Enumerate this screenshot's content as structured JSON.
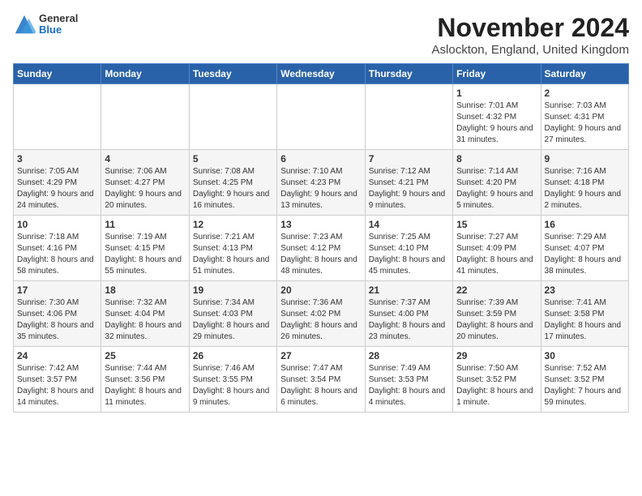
{
  "logo": {
    "general": "General",
    "blue": "Blue"
  },
  "title": "November 2024",
  "subtitle": "Aslockton, England, United Kingdom",
  "days_of_week": [
    "Sunday",
    "Monday",
    "Tuesday",
    "Wednesday",
    "Thursday",
    "Friday",
    "Saturday"
  ],
  "weeks": [
    [
      {
        "day": "",
        "info": ""
      },
      {
        "day": "",
        "info": ""
      },
      {
        "day": "",
        "info": ""
      },
      {
        "day": "",
        "info": ""
      },
      {
        "day": "",
        "info": ""
      },
      {
        "day": "1",
        "info": "Sunrise: 7:01 AM\nSunset: 4:32 PM\nDaylight: 9 hours and 31 minutes."
      },
      {
        "day": "2",
        "info": "Sunrise: 7:03 AM\nSunset: 4:31 PM\nDaylight: 9 hours and 27 minutes."
      }
    ],
    [
      {
        "day": "3",
        "info": "Sunrise: 7:05 AM\nSunset: 4:29 PM\nDaylight: 9 hours and 24 minutes."
      },
      {
        "day": "4",
        "info": "Sunrise: 7:06 AM\nSunset: 4:27 PM\nDaylight: 9 hours and 20 minutes."
      },
      {
        "day": "5",
        "info": "Sunrise: 7:08 AM\nSunset: 4:25 PM\nDaylight: 9 hours and 16 minutes."
      },
      {
        "day": "6",
        "info": "Sunrise: 7:10 AM\nSunset: 4:23 PM\nDaylight: 9 hours and 13 minutes."
      },
      {
        "day": "7",
        "info": "Sunrise: 7:12 AM\nSunset: 4:21 PM\nDaylight: 9 hours and 9 minutes."
      },
      {
        "day": "8",
        "info": "Sunrise: 7:14 AM\nSunset: 4:20 PM\nDaylight: 9 hours and 5 minutes."
      },
      {
        "day": "9",
        "info": "Sunrise: 7:16 AM\nSunset: 4:18 PM\nDaylight: 9 hours and 2 minutes."
      }
    ],
    [
      {
        "day": "10",
        "info": "Sunrise: 7:18 AM\nSunset: 4:16 PM\nDaylight: 8 hours and 58 minutes."
      },
      {
        "day": "11",
        "info": "Sunrise: 7:19 AM\nSunset: 4:15 PM\nDaylight: 8 hours and 55 minutes."
      },
      {
        "day": "12",
        "info": "Sunrise: 7:21 AM\nSunset: 4:13 PM\nDaylight: 8 hours and 51 minutes."
      },
      {
        "day": "13",
        "info": "Sunrise: 7:23 AM\nSunset: 4:12 PM\nDaylight: 8 hours and 48 minutes."
      },
      {
        "day": "14",
        "info": "Sunrise: 7:25 AM\nSunset: 4:10 PM\nDaylight: 8 hours and 45 minutes."
      },
      {
        "day": "15",
        "info": "Sunrise: 7:27 AM\nSunset: 4:09 PM\nDaylight: 8 hours and 41 minutes."
      },
      {
        "day": "16",
        "info": "Sunrise: 7:29 AM\nSunset: 4:07 PM\nDaylight: 8 hours and 38 minutes."
      }
    ],
    [
      {
        "day": "17",
        "info": "Sunrise: 7:30 AM\nSunset: 4:06 PM\nDaylight: 8 hours and 35 minutes."
      },
      {
        "day": "18",
        "info": "Sunrise: 7:32 AM\nSunset: 4:04 PM\nDaylight: 8 hours and 32 minutes."
      },
      {
        "day": "19",
        "info": "Sunrise: 7:34 AM\nSunset: 4:03 PM\nDaylight: 8 hours and 29 minutes."
      },
      {
        "day": "20",
        "info": "Sunrise: 7:36 AM\nSunset: 4:02 PM\nDaylight: 8 hours and 26 minutes."
      },
      {
        "day": "21",
        "info": "Sunrise: 7:37 AM\nSunset: 4:00 PM\nDaylight: 8 hours and 23 minutes."
      },
      {
        "day": "22",
        "info": "Sunrise: 7:39 AM\nSunset: 3:59 PM\nDaylight: 8 hours and 20 minutes."
      },
      {
        "day": "23",
        "info": "Sunrise: 7:41 AM\nSunset: 3:58 PM\nDaylight: 8 hours and 17 minutes."
      }
    ],
    [
      {
        "day": "24",
        "info": "Sunrise: 7:42 AM\nSunset: 3:57 PM\nDaylight: 8 hours and 14 minutes."
      },
      {
        "day": "25",
        "info": "Sunrise: 7:44 AM\nSunset: 3:56 PM\nDaylight: 8 hours and 11 minutes."
      },
      {
        "day": "26",
        "info": "Sunrise: 7:46 AM\nSunset: 3:55 PM\nDaylight: 8 hours and 9 minutes."
      },
      {
        "day": "27",
        "info": "Sunrise: 7:47 AM\nSunset: 3:54 PM\nDaylight: 8 hours and 6 minutes."
      },
      {
        "day": "28",
        "info": "Sunrise: 7:49 AM\nSunset: 3:53 PM\nDaylight: 8 hours and 4 minutes."
      },
      {
        "day": "29",
        "info": "Sunrise: 7:50 AM\nSunset: 3:52 PM\nDaylight: 8 hours and 1 minute."
      },
      {
        "day": "30",
        "info": "Sunrise: 7:52 AM\nSunset: 3:52 PM\nDaylight: 7 hours and 59 minutes."
      }
    ]
  ]
}
